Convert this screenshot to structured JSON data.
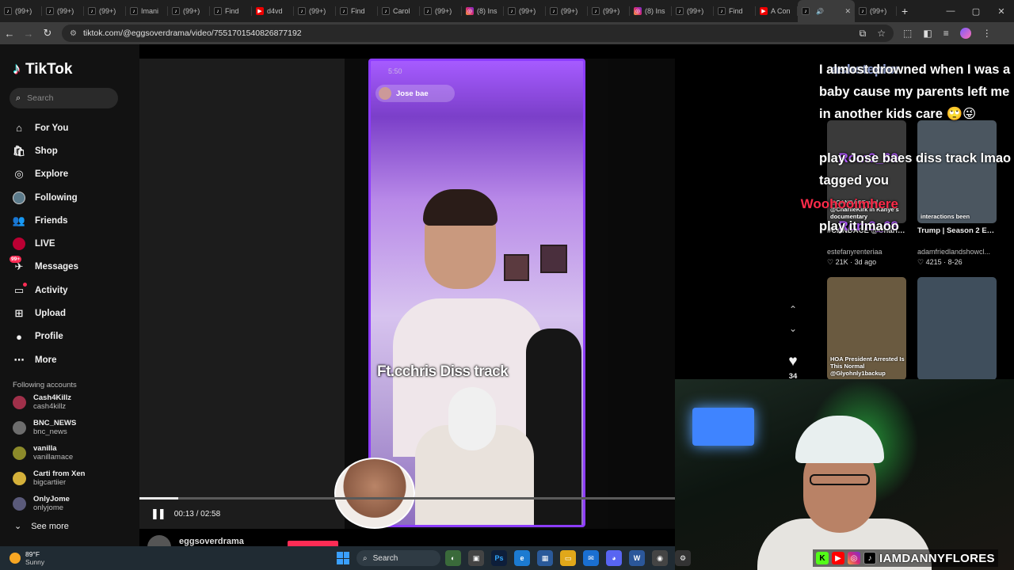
{
  "browser": {
    "tabs": [
      {
        "label": "(99+)",
        "icon": "tiktok-icon"
      },
      {
        "label": "(99+)",
        "icon": "tiktok-icon"
      },
      {
        "label": "(99+)",
        "icon": "tiktok-icon"
      },
      {
        "label": "Imani",
        "icon": "tiktok-icon"
      },
      {
        "label": "(99+)",
        "icon": "tiktok-icon"
      },
      {
        "label": "Find",
        "icon": "tiktok-icon"
      },
      {
        "label": "d4vd",
        "icon": "youtube-icon"
      },
      {
        "label": "(99+)",
        "icon": "tiktok-icon"
      },
      {
        "label": "Find",
        "icon": "tiktok-icon"
      },
      {
        "label": "Carol",
        "icon": "tiktok-icon"
      },
      {
        "label": "(99+)",
        "icon": "tiktok-icon"
      },
      {
        "label": "(8) Ins",
        "icon": "instagram-icon"
      },
      {
        "label": "(99+)",
        "icon": "tiktok-icon"
      },
      {
        "label": "(99+)",
        "icon": "tiktok-icon"
      },
      {
        "label": "(99+)",
        "icon": "tiktok-icon"
      },
      {
        "label": "(8) Ins",
        "icon": "instagram-icon"
      },
      {
        "label": "(99+)",
        "icon": "tiktok-icon"
      },
      {
        "label": "Find",
        "icon": "tiktok-icon"
      },
      {
        "label": "A Con",
        "icon": "youtube-icon"
      },
      {
        "label": "",
        "icon": "tiktok-icon",
        "active": true
      },
      {
        "label": "(99+)",
        "icon": "tiktok-icon"
      }
    ],
    "url": "tiktok.com/@eggsoverdrama/video/7551701540826877192"
  },
  "sidebar": {
    "logo_text": "TikTok",
    "search_placeholder": "Search",
    "nav": [
      {
        "label": "For You",
        "icon": "home-icon"
      },
      {
        "label": "Shop",
        "icon": "shop-icon"
      },
      {
        "label": "Explore",
        "icon": "compass-icon"
      },
      {
        "label": "Following",
        "icon": "following-avatar-icon"
      },
      {
        "label": "Friends",
        "icon": "friends-icon"
      },
      {
        "label": "LIVE",
        "icon": "live-icon"
      },
      {
        "label": "Messages",
        "icon": "messages-icon",
        "badge": "99+"
      },
      {
        "label": "Activity",
        "icon": "activity-icon",
        "badge": "4"
      },
      {
        "label": "Upload",
        "icon": "upload-icon"
      },
      {
        "label": "Profile",
        "icon": "profile-icon"
      },
      {
        "label": "More",
        "icon": "more-icon"
      }
    ],
    "following_title": "Following accounts",
    "accounts": [
      {
        "name": "Cash4Killz",
        "handle": "cash4killz",
        "color": "#a0304a"
      },
      {
        "name": "BNC_NEWS",
        "handle": "bnc_news",
        "color": "#6d6d6d"
      },
      {
        "name": "vanilla",
        "handle": "vanillamace",
        "color": "#8c8a2a"
      },
      {
        "name": "Carti from Xen",
        "handle": "bigcartiier",
        "color": "#d4b03a"
      },
      {
        "name": "OnlyJome",
        "handle": "onlyjome",
        "color": "#5a5a7a"
      }
    ],
    "see_more": "See more"
  },
  "video": {
    "phone_status_time": "5:50",
    "overlay_user": "Jose bae",
    "caption": "Ft.cchris Diss track",
    "progress": 0.073,
    "time_display": "00:13 / 02:58",
    "author": "eggsoverdrama",
    "like_count": "34"
  },
  "chat": [
    {
      "user": "ashstephx",
      "color": "#9fb0e8",
      "message": "I almost drowned when I was a baby cause my parents left me in another kids care 🙄😜"
    },
    {
      "user": "Rom3_69",
      "color": "#b25bff",
      "message": "play Jose baes diss track lmao tagged you"
    },
    {
      "user": "Woohooimhere",
      "color": "#ff2b4a",
      "message": ""
    },
    {
      "user": "Rom3_69",
      "color": "#b25bff",
      "message": "play it lmaoo"
    }
  ],
  "recommended": [
    {
      "title": "#CANDACE @Charlie Kirk I'm...",
      "author": "estefanyrenteriaa",
      "likes": "21K",
      "age": "3d ago",
      "thumb_text": "@CANDACE and @CharlieKirk in Kanye's documentary",
      "thumb_color": "#3a3a3a"
    },
    {
      "title": "Trump | Season 2 Episode 10 | Ritchie...",
      "author": "adamfriedlandshowcl...",
      "likes": "4215",
      "age": "8-26",
      "thumb_text": "interactions been",
      "thumb_color": "#4b5660"
    },
    {
      "title": "",
      "author": "",
      "likes": "",
      "age": "",
      "thumb_text": "HOA President Arrested Is This Normal @Glyohnly1backup",
      "thumb_color": "#6a5a40"
    },
    {
      "title": "",
      "author": "",
      "likes": "",
      "age": "",
      "thumb_text": "",
      "thumb_color": "#3f4e5c"
    }
  ],
  "webcam": {
    "handle": "IAMDANNYFLORES"
  },
  "taskbar": {
    "temperature": "89°F",
    "condition": "Sunny",
    "search_label": "Search"
  }
}
